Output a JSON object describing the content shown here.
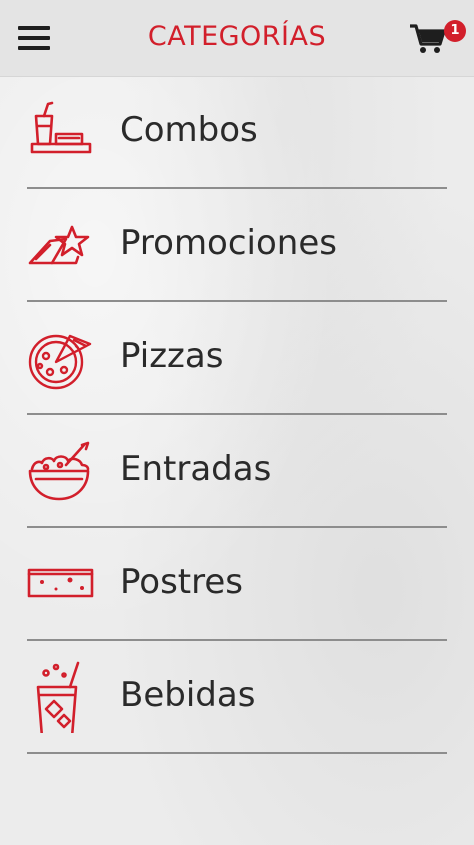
{
  "header": {
    "title": "CATEGORÍAS",
    "menu_icon": "hamburger-menu-icon",
    "cart_icon": "shopping-cart-icon",
    "cart_count": "1"
  },
  "colors": {
    "accent": "#d21f2b",
    "text": "#2a2a2a",
    "divider": "#8d8d8d"
  },
  "categories": [
    {
      "label": "Combos",
      "icon": "combo-tray-icon"
    },
    {
      "label": "Promociones",
      "icon": "promo-star-icon"
    },
    {
      "label": "Pizzas",
      "icon": "pizza-icon"
    },
    {
      "label": "Entradas",
      "icon": "bowl-icon"
    },
    {
      "label": "Postres",
      "icon": "dessert-icon"
    },
    {
      "label": "Bebidas",
      "icon": "drink-glass-icon"
    }
  ]
}
